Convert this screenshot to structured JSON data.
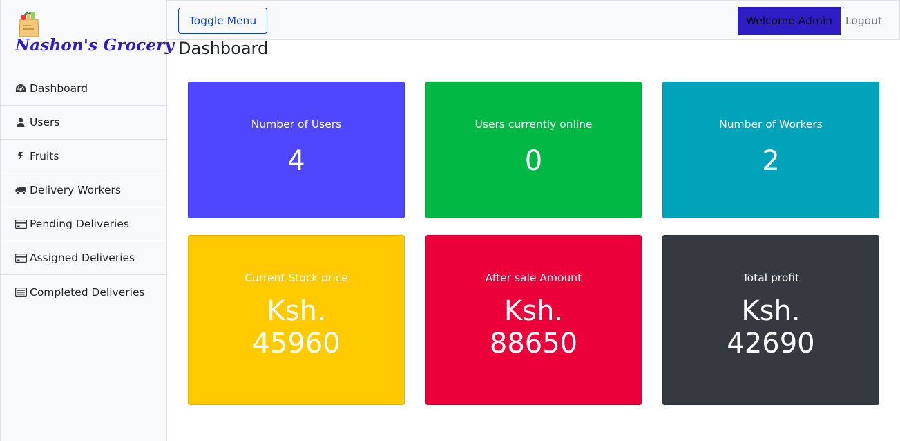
{
  "brand": {
    "name": "Nashon's Grocery",
    "logo_icon": "grocery-bag-icon"
  },
  "sidebar": {
    "items": [
      {
        "label": "Dashboard",
        "icon": "tachometer-icon"
      },
      {
        "label": "Users",
        "icon": "user-icon"
      },
      {
        "label": "Fruits",
        "icon": "fruit-icon"
      },
      {
        "label": "Delivery Workers",
        "icon": "truck-icon"
      },
      {
        "label": "Pending Deliveries",
        "icon": "credit-card-icon"
      },
      {
        "label": "Assigned Deliveries",
        "icon": "credit-card-icon"
      },
      {
        "label": "Completed Deliveries",
        "icon": "list-alt-icon"
      }
    ]
  },
  "topbar": {
    "toggle_label": "Toggle Menu",
    "welcome_label": "Welcome Admin",
    "logout_label": "Logout"
  },
  "main": {
    "title": "Dashboard",
    "cards": [
      {
        "label": "Number of Users",
        "value": "4",
        "color": "#4f47ff"
      },
      {
        "label": "Users currently online",
        "value": "0",
        "color": "#00b843"
      },
      {
        "label": "Number of Workers",
        "value": "2",
        "color": "#00a3ba"
      },
      {
        "label": "Current Stock price",
        "value_prefix": "Ksh.",
        "value": "45960",
        "color": "#ffcb00"
      },
      {
        "label": "After sale Amount",
        "value_prefix": "Ksh.",
        "value": "88650",
        "color": "#eb0039"
      },
      {
        "label": "Total profit",
        "value_prefix": "Ksh.",
        "value": "42690",
        "color": "#343a40"
      }
    ]
  },
  "colors": {
    "brand": "#2e1cc4",
    "accent": "#0d3fd1"
  }
}
